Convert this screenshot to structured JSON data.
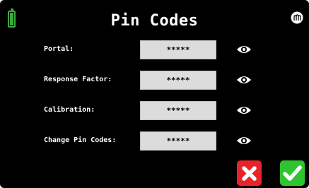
{
  "header": {
    "title": "Pin Codes",
    "battery_icon": "battery-icon",
    "logo_icon": "brand-logo-icon"
  },
  "rows": [
    {
      "label": "Portal:",
      "value": "*****",
      "reveal_icon": "eye-icon"
    },
    {
      "label": "Response Factor:",
      "value": "*****",
      "reveal_icon": "eye-icon"
    },
    {
      "label": "Calibration:",
      "value": "*****",
      "reveal_icon": "eye-icon"
    },
    {
      "label": "Change Pin Codes:",
      "value": "*****",
      "reveal_icon": "eye-icon"
    }
  ],
  "actions": {
    "cancel_icon": "x-icon",
    "confirm_icon": "checkmark-icon"
  },
  "colors": {
    "background": "#000000",
    "battery": "#3ea83e",
    "field": "#dcdcdc",
    "cancel": "#e8232a",
    "confirm": "#2fc42f"
  }
}
